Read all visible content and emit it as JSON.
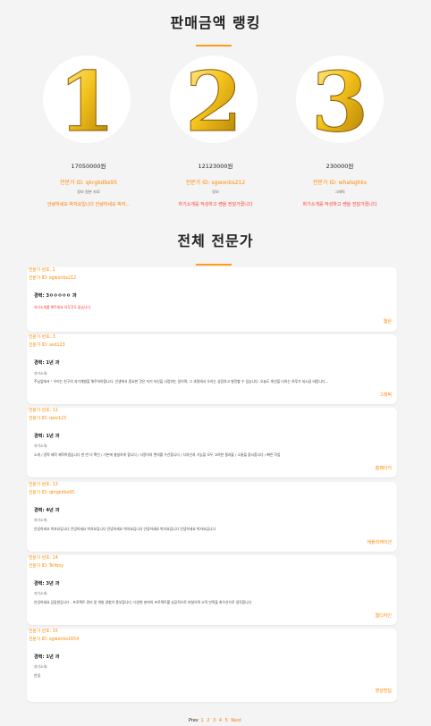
{
  "ranking": {
    "title": "판매금액 랭킹",
    "entries": [
      {
        "rank": "1",
        "amount": "17050000원",
        "id_label": "전문가 ID: qkrgkdbs95",
        "name": "정보 원본 자료",
        "note": "안녕하세요 박자요입니다 안녕하세요 박자...",
        "note_color": "orange"
      },
      {
        "rank": "2",
        "amount": "12123000원",
        "id_label": "전문가 ID: sgwonbs212",
        "name": "정보",
        "note": "하기소개를 작성하고 쌩을 전달가졌니다",
        "note_color": "red"
      },
      {
        "rank": "3",
        "amount": "230000원",
        "id_label": "전문가 ID: whalsghks",
        "name": "그래픽",
        "note": "하기소개를 작성하고 쌩을 전달가졌니다",
        "note_color": "red"
      }
    ]
  },
  "experts": {
    "title": "전체 전문가",
    "cards": [
      {
        "seq": "전문가 번호: 1",
        "id": "전문가 ID: sgwonbs212",
        "career": "경력: 3ㅇㅇㅇㅇㅇ 과",
        "intro_label": "",
        "intro": "자기소개를 해주세요 아무것도 없습니다",
        "intro_red": true,
        "author": "웹원"
      },
      {
        "seq": "전문가 번호: 3",
        "id": "전문가 ID: asd123",
        "career": "경력: 1년 과",
        "intro_label": "자기소개:",
        "intro": "주님앞에서 \" 우리는 친구의 자기계발을 해주어야합니다. 인생에서 중요한 것은 자기 자신을 사랑하는 일이며, 그 과정에서 우리는 성장하고 발전할 수 있습니다. 오늘도 최선을 다하는 하루가 되시길 바랍니다...",
        "intro_red": false,
        "author": "그래픽"
      },
      {
        "seq": "전문가 번호: 11",
        "id": "전문가 ID: qwe123",
        "career": "경력: 1년 과",
        "intro_label": "자기소개:",
        "intro": "소개 / 경력 제작 제작하겠습니다 한 번 더 확인 / 기본에 충실하게 합니다 / 사용자의 편의를 우선합니다 / 디자인과 기능을 모두 고려한 결과물 / 소통을 중시합니다 / 빠른 작업",
        "intro_red": false,
        "author": "홈페이지"
      },
      {
        "seq": "전문가 번호: 13",
        "id": "전문가 ID: qkrgkdbs95",
        "career": "경력: 4년 과",
        "intro_label": "자기소개:",
        "intro": "안녕하세요 박자요입니다 안녕하세요 박자요입니다 안녕하세요 박자요입니다 안녕하세요 박자요입니다 안녕하세요 박자요입니다",
        "intro_red": false,
        "author": "애플리케이션"
      },
      {
        "seq": "전문가 번호: 14",
        "id": "전문가 ID: TeYooy",
        "career": "경력: 3년 과",
        "intro_label": "자기소개:",
        "intro": "안녕하세요 김동원입니다 - 프로젝트 관리 및 개발 경험이 풍부합니다. 다양한 분야의 프로젝트를 성공적으로 마쳤으며 고객 만족을 최우선으로 생각합니다",
        "intro_red": false,
        "author": "웹디자인"
      },
      {
        "seq": "전문가 번호: 15",
        "id": "전문가 ID: sgwonbs1654",
        "career": "경력: 1년 과",
        "intro_label": "자기소개:",
        "intro": "안녕",
        "intro_red": false,
        "author": "영상편집"
      }
    ]
  },
  "pagination": {
    "prev": "Prev",
    "pages": [
      "1",
      "2",
      "3",
      "4",
      "5"
    ],
    "next": "Next"
  },
  "colors": {
    "accent": "#ff9a1a",
    "link_orange": "#ff8a00",
    "red": "#ff3b30",
    "gold": "#e6b422"
  }
}
